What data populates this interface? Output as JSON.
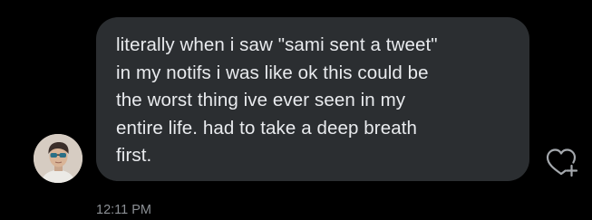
{
  "message": {
    "text": "literally when i saw \"sami sent a tweet\"\nin my notifs i was like ok this could be\nthe worst thing ive ever seen in my\nentire life. had to take a deep breath\nfirst.",
    "timestamp": "12:11 PM"
  },
  "sender": {
    "avatar_icon": "person-avatar-with-sunglasses"
  },
  "actions": {
    "like_icon": "heart-plus-icon"
  },
  "colors": {
    "background": "#000000",
    "bubble": "#2b2e31",
    "text": "#e9ebee",
    "timestamp": "#8b8f94",
    "icon": "#a4a8ad"
  }
}
